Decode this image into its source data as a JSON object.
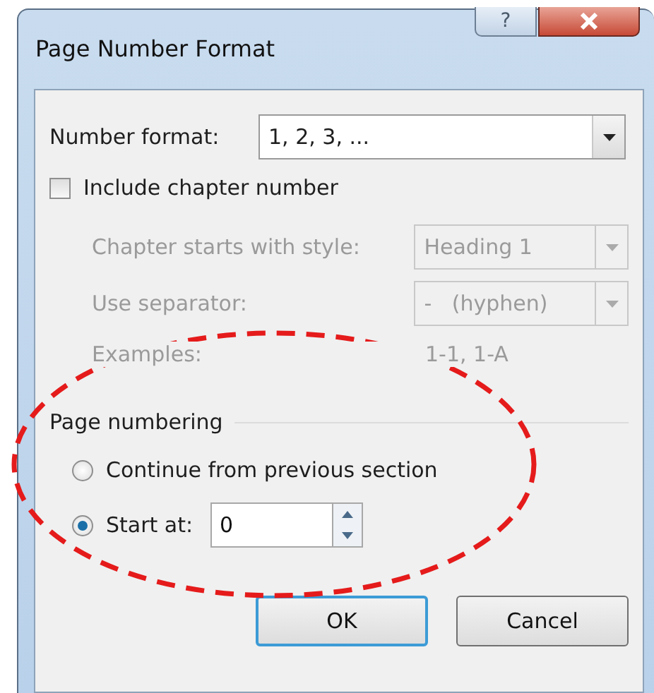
{
  "window": {
    "title": "Page Number Format",
    "help_button": "?"
  },
  "number_format": {
    "label": "Number format:",
    "value": "1, 2, 3, ..."
  },
  "include_chapter_number": {
    "label": "Include chapter number",
    "checked": false
  },
  "chapter_style": {
    "label": "Chapter starts with style:",
    "value": "Heading 1",
    "disabled": true
  },
  "separator": {
    "label": "Use separator:",
    "value": "-   (hyphen)",
    "disabled": true
  },
  "examples": {
    "label": "Examples:",
    "value": "1-1, 1-A",
    "disabled": true
  },
  "page_numbering": {
    "heading": "Page numbering",
    "options": [
      {
        "label": "Continue from previous section",
        "selected": false
      },
      {
        "label": "Start at:",
        "selected": true
      }
    ],
    "start_at": "0"
  },
  "buttons": [
    {
      "label": "OK",
      "default": true
    },
    {
      "label": "Cancel",
      "default": false
    }
  ]
}
